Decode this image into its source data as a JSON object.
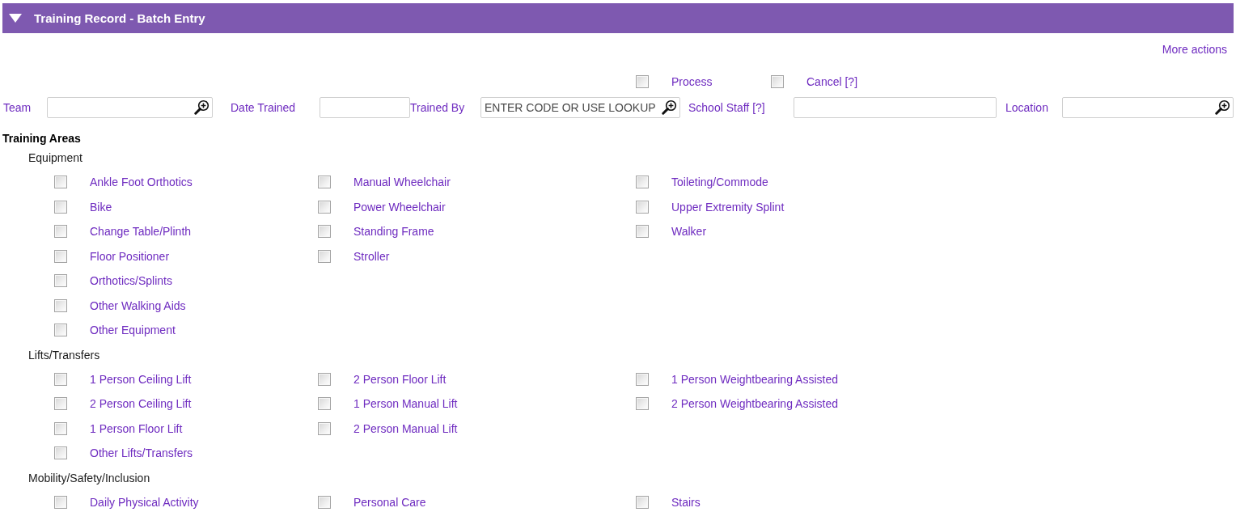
{
  "panel": {
    "title": "Training Record - Batch Entry",
    "expanded": true
  },
  "more_actions": "More actions",
  "options": [
    {
      "label": "Process",
      "checked": false
    },
    {
      "label": "Cancel [?]",
      "checked": false
    }
  ],
  "fields": [
    {
      "label": "Team",
      "kind": "lookup"
    },
    {
      "label": "Date Trained",
      "kind": "text"
    },
    {
      "label": "Trained By",
      "kind": "lookup",
      "placeholder": "ENTER CODE OR USE LOOKUP"
    },
    {
      "label": "School Staff [?]",
      "kind": "text"
    },
    {
      "label": "Location",
      "kind": "lookup"
    }
  ],
  "training_areas": {
    "title": "Training Areas",
    "groups": [
      {
        "title": "Equipment",
        "columns": [
          [
            {
              "label": "Ankle Foot Orthotics",
              "checked": false
            },
            {
              "label": "Bike",
              "checked": false
            },
            {
              "label": "Change Table/Plinth",
              "checked": false
            },
            {
              "label": "Floor Positioner",
              "checked": false
            },
            {
              "label": "Orthotics/Splints",
              "checked": false
            },
            {
              "label": "Other Walking Aids",
              "checked": false
            },
            {
              "label": "Other Equipment",
              "checked": false
            }
          ],
          [
            {
              "label": "Manual Wheelchair",
              "checked": false
            },
            {
              "label": "Power Wheelchair",
              "checked": false
            },
            {
              "label": "Standing Frame",
              "checked": false
            },
            {
              "label": "Stroller",
              "checked": false
            }
          ],
          [
            {
              "label": "Toileting/Commode",
              "checked": false
            },
            {
              "label": "Upper Extremity Splint",
              "checked": false
            },
            {
              "label": "Walker",
              "checked": false
            }
          ]
        ]
      },
      {
        "title": "Lifts/Transfers",
        "columns": [
          [
            {
              "label": "1 Person Ceiling Lift",
              "checked": false
            },
            {
              "label": "2 Person Ceiling Lift",
              "checked": false
            },
            {
              "label": "1 Person Floor Lift",
              "checked": false
            },
            {
              "label": "Other Lifts/Transfers",
              "checked": false
            }
          ],
          [
            {
              "label": "2 Person Floor Lift",
              "checked": false
            },
            {
              "label": "1 Person Manual Lift",
              "checked": false
            },
            {
              "label": "2 Person Manual Lift",
              "checked": false
            }
          ],
          [
            {
              "label": "1 Person Weightbearing Assisted",
              "checked": false
            },
            {
              "label": "2 Person Weightbearing Assisted",
              "checked": false
            }
          ]
        ]
      },
      {
        "title": "Mobility/Safety/Inclusion",
        "columns": [
          [
            {
              "label": "Daily Physical Activity",
              "checked": false
            }
          ],
          [
            {
              "label": "Personal Care",
              "checked": false
            }
          ],
          [
            {
              "label": "Stairs",
              "checked": false
            }
          ]
        ]
      }
    ]
  }
}
